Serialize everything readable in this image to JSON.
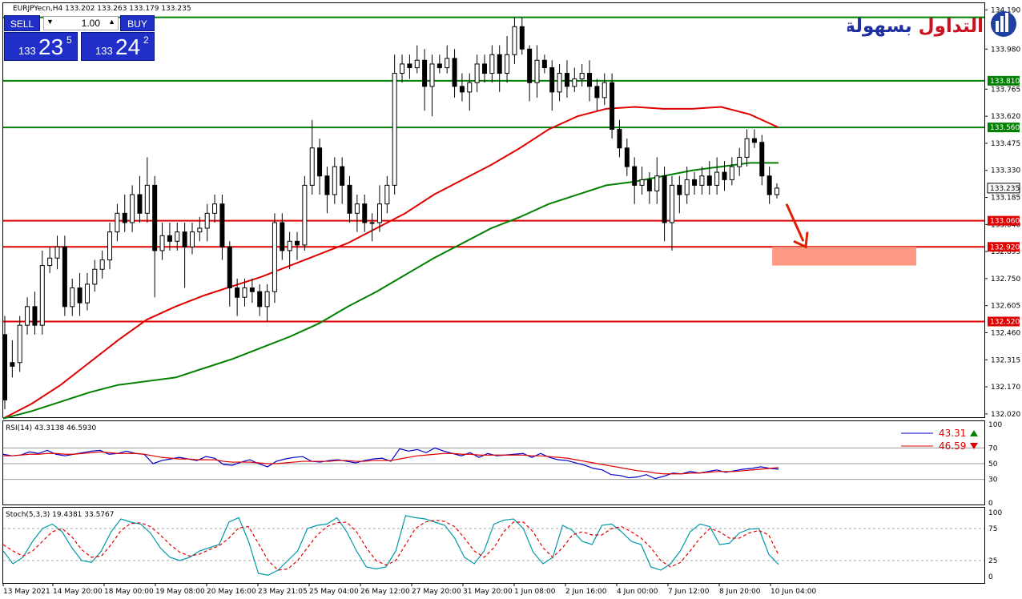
{
  "header": {
    "symbol_info": "EURJPYecn,H4  133.202 133.263 133.179 133.235"
  },
  "trade_panel": {
    "sell_label": "SELL",
    "buy_label": "BUY",
    "lot": "1.00",
    "sell_small": "133",
    "sell_big": "23",
    "sell_sup": "5",
    "buy_small": "133",
    "buy_big": "24",
    "buy_sup": "2"
  },
  "logo_text": "التداول بسهولة",
  "chart_data": [
    {
      "type": "candlestick",
      "title": "EURJPYecn,H4",
      "ylim": [
        132.02,
        134.2
      ],
      "y_ticks": [
        134.19,
        133.98,
        133.765,
        133.62,
        133.475,
        133.33,
        133.185,
        133.04,
        132.895,
        132.75,
        132.605,
        132.46,
        132.315,
        132.17,
        132.025
      ],
      "y_tick_labels": [
        "134.190",
        "133.980",
        "133.765",
        "133.620",
        "133.475",
        "133.330",
        "133.185",
        "133.040",
        "132.895",
        "132.750",
        "132.605",
        "132.460",
        "132.315",
        "132.170",
        "132.020"
      ],
      "x_labels": [
        "13 May 2021",
        "14 May 20:00",
        "18 May 00:00",
        "19 May 08:00",
        "20 May 16:00",
        "23 May 21:05",
        "25 May 04:00",
        "26 May 12:00",
        "27 May 20:00",
        "31 May 20:00",
        "1 Jun 08:00",
        "2 Jun 16:00",
        "4 Jun 00:00",
        "7 Jun 12:00",
        "8 Jun 20:00",
        "10 Jun 04:00"
      ],
      "candles": [
        [
          132.45,
          132.1,
          132.55,
          132.05
        ],
        [
          132.3,
          132.28,
          132.42,
          132.22
        ],
        [
          132.3,
          132.5,
          132.55,
          132.25
        ],
        [
          132.5,
          132.6,
          132.65,
          132.45
        ],
        [
          132.6,
          132.5,
          132.68,
          132.45
        ],
        [
          132.5,
          132.82,
          132.9,
          132.45
        ],
        [
          132.82,
          132.86,
          132.92,
          132.78
        ],
        [
          132.86,
          132.92,
          132.98,
          132.8
        ],
        [
          132.92,
          132.6,
          132.98,
          132.55
        ],
        [
          132.6,
          132.7,
          132.75,
          132.55
        ],
        [
          132.7,
          132.62,
          132.78,
          132.55
        ],
        [
          132.62,
          132.72,
          132.78,
          132.58
        ],
        [
          132.72,
          132.8,
          132.85,
          132.68
        ],
        [
          132.8,
          132.85,
          132.9,
          132.75
        ],
        [
          132.85,
          133.0,
          133.05,
          132.8
        ],
        [
          133.0,
          133.1,
          133.15,
          132.95
        ],
        [
          133.1,
          133.05,
          133.2,
          133.0
        ],
        [
          133.05,
          133.2,
          133.25,
          133.0
        ],
        [
          133.2,
          133.1,
          133.3,
          133.05
        ],
        [
          133.1,
          133.25,
          133.4,
          133.05
        ],
        [
          133.25,
          132.9,
          133.3,
          132.65
        ],
        [
          132.9,
          132.98,
          133.05,
          132.85
        ],
        [
          132.98,
          132.95,
          133.05,
          132.9
        ],
        [
          132.95,
          133.0,
          133.05,
          132.9
        ],
        [
          133.0,
          132.92,
          133.05,
          132.7
        ],
        [
          132.92,
          133.0,
          133.05,
          132.88
        ],
        [
          133.0,
          133.02,
          133.08,
          132.95
        ],
        [
          133.02,
          133.1,
          133.15,
          132.95
        ],
        [
          133.1,
          133.15,
          133.2,
          133.05
        ],
        [
          133.15,
          132.92,
          133.2,
          132.85
        ],
        [
          132.92,
          132.7,
          132.95,
          132.6
        ],
        [
          132.7,
          132.65,
          132.75,
          132.55
        ],
        [
          132.65,
          132.7,
          132.75,
          132.6
        ],
        [
          132.7,
          132.68,
          132.75,
          132.62
        ],
        [
          132.68,
          132.6,
          132.72,
          132.55
        ],
        [
          132.6,
          132.68,
          132.72,
          132.52
        ],
        [
          132.68,
          133.05,
          133.1,
          132.62
        ],
        [
          133.05,
          132.9,
          133.1,
          132.85
        ],
        [
          132.9,
          132.95,
          133.0,
          132.8
        ],
        [
          132.95,
          132.93,
          133.0,
          132.85
        ],
        [
          132.93,
          133.25,
          133.3,
          132.9
        ],
        [
          133.25,
          133.45,
          133.6,
          133.2
        ],
        [
          133.45,
          133.3,
          133.5,
          133.2
        ],
        [
          133.3,
          133.2,
          133.35,
          133.1
        ],
        [
          133.2,
          133.35,
          133.4,
          133.15
        ],
        [
          133.35,
          133.25,
          133.4,
          133.15
        ],
        [
          133.25,
          133.1,
          133.3,
          133.05
        ],
        [
          133.1,
          133.15,
          133.2,
          133.0
        ],
        [
          133.15,
          133.05,
          133.2,
          133.0
        ],
        [
          133.05,
          133.05,
          133.1,
          132.95
        ],
        [
          133.05,
          133.15,
          133.25,
          133.0
        ],
        [
          133.15,
          133.25,
          133.3,
          133.1
        ],
        [
          133.25,
          133.85,
          133.95,
          133.2
        ],
        [
          133.85,
          133.9,
          133.95,
          133.8
        ],
        [
          133.9,
          133.88,
          133.95,
          133.82
        ],
        [
          133.88,
          133.92,
          134.0,
          133.85
        ],
        [
          133.92,
          133.78,
          133.98,
          133.65
        ],
        [
          133.78,
          133.9,
          133.95,
          133.62
        ],
        [
          133.9,
          133.88,
          133.95,
          133.85
        ],
        [
          133.88,
          133.93,
          134.0,
          133.85
        ],
        [
          133.93,
          133.78,
          133.98,
          133.72
        ],
        [
          133.78,
          133.75,
          133.85,
          133.7
        ],
        [
          133.75,
          133.8,
          133.85,
          133.65
        ],
        [
          133.8,
          133.9,
          133.95,
          133.75
        ],
        [
          133.9,
          133.85,
          133.95,
          133.8
        ],
        [
          133.85,
          133.95,
          134.0,
          133.8
        ],
        [
          133.95,
          133.85,
          134.0,
          133.75
        ],
        [
          133.85,
          133.95,
          134.05,
          133.8
        ],
        [
          133.95,
          134.1,
          134.15,
          133.9
        ],
        [
          134.1,
          133.98,
          134.15,
          133.95
        ],
        [
          133.98,
          133.8,
          134.0,
          133.7
        ],
        [
          133.8,
          133.92,
          134.0,
          133.72
        ],
        [
          133.92,
          133.88,
          133.95,
          133.85
        ],
        [
          133.88,
          133.75,
          133.92,
          133.65
        ],
        [
          133.75,
          133.85,
          133.9,
          133.7
        ],
        [
          133.85,
          133.78,
          133.92,
          133.72
        ],
        [
          133.78,
          133.82,
          133.88,
          133.75
        ],
        [
          133.82,
          133.85,
          133.9,
          133.78
        ],
        [
          133.85,
          133.78,
          133.92,
          133.7
        ],
        [
          133.78,
          133.72,
          133.82,
          133.65
        ],
        [
          133.72,
          133.8,
          133.85,
          133.68
        ],
        [
          133.8,
          133.55,
          133.85,
          133.5
        ],
        [
          133.55,
          133.45,
          133.6,
          133.4
        ],
        [
          133.45,
          133.35,
          133.5,
          133.3
        ],
        [
          133.35,
          133.25,
          133.4,
          133.15
        ],
        [
          133.25,
          133.28,
          133.35,
          133.2
        ],
        [
          133.28,
          133.22,
          133.32,
          133.15
        ],
        [
          133.22,
          133.3,
          133.4,
          133.15
        ],
        [
          133.3,
          133.05,
          133.35,
          132.95
        ],
        [
          133.05,
          133.25,
          133.3,
          132.9
        ],
        [
          133.25,
          133.2,
          133.3,
          133.1
        ],
        [
          133.2,
          133.28,
          133.35,
          133.15
        ],
        [
          133.28,
          133.25,
          133.32,
          133.2
        ],
        [
          133.25,
          133.3,
          133.35,
          133.2
        ],
        [
          133.3,
          133.25,
          133.38,
          133.2
        ],
        [
          133.25,
          133.32,
          133.4,
          133.2
        ],
        [
          133.32,
          133.28,
          133.38,
          133.22
        ],
        [
          133.28,
          133.35,
          133.4,
          133.25
        ],
        [
          133.35,
          133.4,
          133.45,
          133.3
        ],
        [
          133.4,
          133.5,
          133.55,
          133.35
        ],
        [
          133.5,
          133.48,
          133.55,
          133.45
        ],
        [
          133.48,
          133.3,
          133.52,
          133.25
        ],
        [
          133.3,
          133.2,
          133.35,
          133.15
        ],
        [
          133.2,
          133.235,
          133.26,
          133.18
        ]
      ],
      "ma_series": [
        {
          "color": "#e00000",
          "values": [
            132.0,
            132.08,
            132.18,
            132.3,
            132.42,
            132.53,
            132.6,
            132.66,
            132.71,
            132.76,
            132.82,
            132.88,
            132.94,
            133.02,
            133.1,
            133.2,
            133.28,
            133.36,
            133.45,
            133.55,
            133.62,
            133.66,
            133.67,
            133.66,
            133.66,
            133.67,
            133.63,
            133.56
          ]
        },
        {
          "color": "#008000",
          "values": [
            132.0,
            132.04,
            132.09,
            132.14,
            132.18,
            132.2,
            132.22,
            132.27,
            132.32,
            132.38,
            132.44,
            132.51,
            132.6,
            132.68,
            132.77,
            132.86,
            132.94,
            133.02,
            133.08,
            133.15,
            133.2,
            133.25,
            133.27,
            133.3,
            133.33,
            133.35,
            133.37,
            133.37
          ]
        }
      ],
      "levels": [
        {
          "value": 134.15,
          "color": "#008000",
          "label": ""
        },
        {
          "value": 133.81,
          "color": "#008000",
          "label": "133.810"
        },
        {
          "value": 133.56,
          "color": "#008000",
          "label": "133.560"
        },
        {
          "value": 133.06,
          "color": "#e00000",
          "label": "133.060"
        },
        {
          "value": 132.92,
          "color": "#e00000",
          "label": "132.920"
        },
        {
          "value": 132.52,
          "color": "#e00000",
          "label": "132.520"
        }
      ],
      "price_tag": "133.235",
      "target_zone": [
        132.82,
        132.92
      ],
      "target_zone_color": "#ff9a84",
      "arrow_color": "#e02000"
    },
    {
      "type": "line",
      "title": "RSI(14) 43.3138 46.5930",
      "ylim": [
        0,
        100
      ],
      "y_ticks": [
        100,
        70,
        50,
        30,
        0
      ],
      "levels": [
        70,
        50,
        30
      ],
      "legend": [
        {
          "name": "43.31",
          "color": "#0000cc",
          "direction": "up"
        },
        {
          "name": "46.59",
          "color": "#e00000",
          "direction": "down"
        }
      ],
      "series": [
        {
          "color": "#0000cc",
          "values": [
            62,
            60,
            61,
            65,
            63,
            67,
            62,
            60,
            62,
            64,
            66,
            67,
            62,
            63,
            66,
            63,
            62,
            50,
            54,
            56,
            58,
            56,
            54,
            59,
            57,
            49,
            48,
            52,
            55,
            50,
            46,
            53,
            56,
            58,
            59,
            53,
            52,
            54,
            55,
            53,
            51,
            54,
            56,
            57,
            53,
            69,
            66,
            68,
            64,
            70,
            66,
            63,
            60,
            64,
            58,
            63,
            60,
            61,
            62,
            63,
            58,
            63,
            58,
            55,
            54,
            51,
            48,
            44,
            42,
            36,
            35,
            32,
            33,
            36,
            31,
            34,
            38,
            37,
            40,
            38,
            40,
            42,
            39,
            41,
            43,
            44,
            46,
            44,
            43
          ]
        },
        {
          "color": "#e00000",
          "values": [
            60,
            60,
            61,
            62,
            62,
            63,
            63,
            62,
            62,
            63,
            64,
            65,
            64,
            63,
            63,
            63,
            62,
            60,
            58,
            57,
            56,
            56,
            55,
            55,
            55,
            53,
            52,
            52,
            52,
            51,
            50,
            50,
            51,
            52,
            53,
            53,
            53,
            53,
            54,
            54,
            53,
            53,
            54,
            54,
            54,
            56,
            58,
            60,
            61,
            62,
            63,
            63,
            62,
            62,
            61,
            61,
            61,
            61,
            61,
            61,
            60,
            60,
            59,
            58,
            57,
            55,
            53,
            51,
            49,
            47,
            45,
            43,
            41,
            40,
            38,
            37,
            37,
            37,
            38,
            38,
            39,
            40,
            40,
            40,
            41,
            42,
            43,
            44,
            45
          ]
        }
      ]
    },
    {
      "type": "line",
      "title": "Stoch(5,3,3) 19.4381 33.5767",
      "ylim": [
        0,
        100
      ],
      "y_ticks": [
        100,
        75,
        25,
        0
      ],
      "levels": [
        75,
        25
      ],
      "series": [
        {
          "color": "#0099aa",
          "values": [
            40,
            20,
            30,
            55,
            75,
            82,
            70,
            45,
            25,
            22,
            40,
            70,
            90,
            85,
            82,
            68,
            45,
            30,
            25,
            30,
            40,
            45,
            50,
            85,
            92,
            55,
            5,
            2,
            10,
            25,
            40,
            75,
            80,
            82,
            92,
            70,
            40,
            15,
            12,
            15,
            40,
            95,
            92,
            90,
            85,
            80,
            60,
            30,
            20,
            40,
            82,
            88,
            90,
            75,
            38,
            20,
            30,
            80,
            72,
            55,
            50,
            80,
            82,
            70,
            55,
            50,
            15,
            10,
            20,
            40,
            70,
            82,
            78,
            50,
            52,
            68,
            74,
            75,
            35,
            19
          ]
        },
        {
          "color": "#e00000",
          "values": [
            50,
            40,
            32,
            40,
            55,
            70,
            75,
            62,
            42,
            30,
            32,
            50,
            72,
            83,
            84,
            78,
            65,
            50,
            38,
            32,
            35,
            42,
            48,
            60,
            76,
            78,
            52,
            25,
            10,
            12,
            25,
            45,
            65,
            78,
            84,
            85,
            70,
            45,
            25,
            18,
            25,
            50,
            75,
            85,
            88,
            86,
            78,
            60,
            40,
            30,
            45,
            70,
            85,
            85,
            70,
            45,
            30,
            45,
            65,
            70,
            65,
            65,
            75,
            78,
            70,
            60,
            45,
            25,
            15,
            22,
            40,
            60,
            75,
            70,
            60,
            60,
            68,
            72,
            65,
            34
          ]
        }
      ]
    }
  ]
}
